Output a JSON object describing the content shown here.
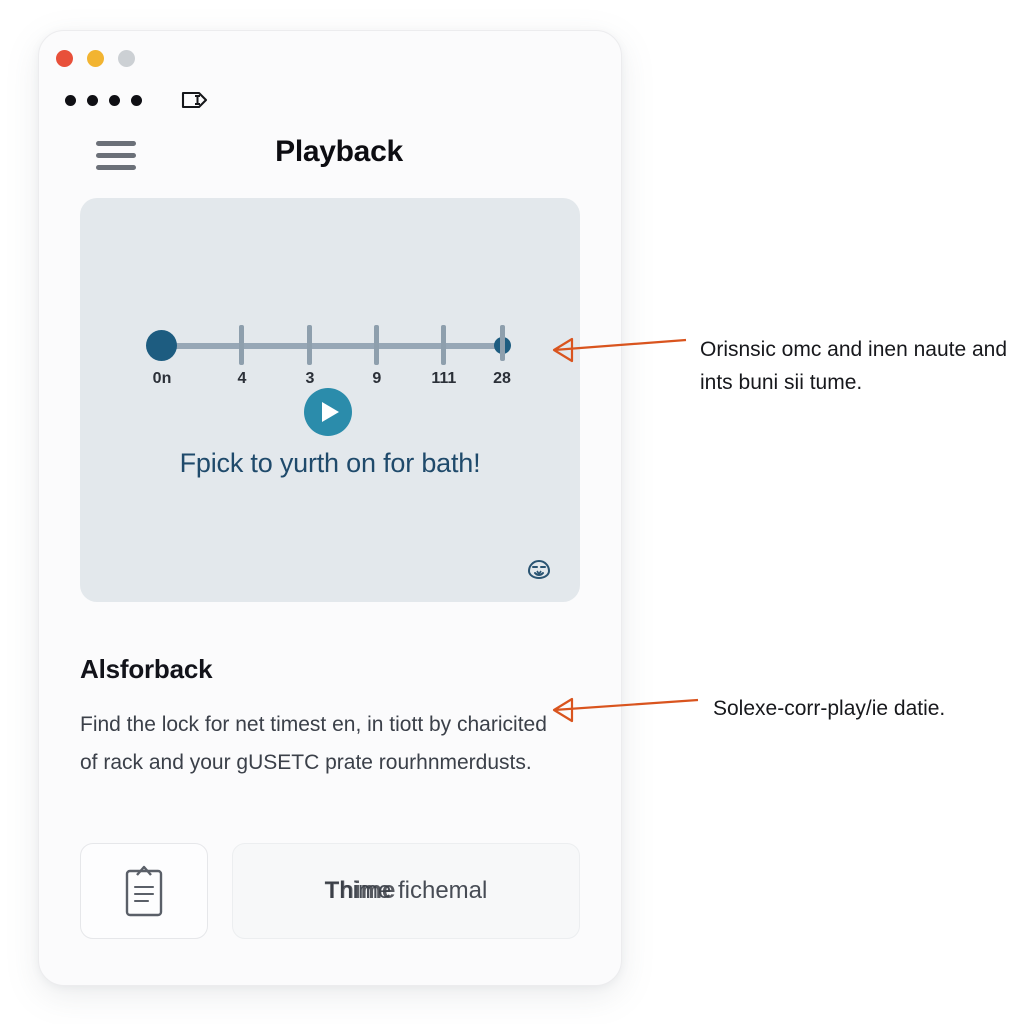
{
  "window": {
    "traffic_lights": [
      {
        "name": "close",
        "color": "#e8503a"
      },
      {
        "name": "minimize",
        "color": "#f2b431"
      },
      {
        "name": "maximize",
        "color": "#ccd0d4"
      }
    ],
    "status_dots_count": 4,
    "tag_icon": "tag-icon"
  },
  "app_bar": {
    "menu_icon": "hamburger-icon",
    "title": "Playback"
  },
  "media_card": {
    "caption": "Fpick to yurth on for bath!",
    "play_icon": "play-icon",
    "corner_icon": "face-icon",
    "timeline": {
      "start_label": "0n",
      "ticks": [
        {
          "label": "0n",
          "pos_pct": 0
        },
        {
          "label": "4",
          "pos_pct": 23.5
        },
        {
          "label": "3",
          "pos_pct": 43.5
        },
        {
          "label": "9",
          "pos_pct": 63.2
        },
        {
          "label": "111",
          "pos_pct": 82.9
        },
        {
          "label": "28",
          "pos_pct": 100
        }
      ]
    }
  },
  "info_section": {
    "heading": "Alsforback",
    "body": "Find the lock for net timest en, in tiott by charicited of rack and your gUSETC prate rourhnmerdusts."
  },
  "actions": {
    "clipboard_icon": "clipboard-icon",
    "primary_label": "Thime fichemal"
  },
  "annotations": [
    {
      "id": "annotation-1",
      "text": "Orisnsic omc and inen naute and ints buni sii tume.",
      "arrow_color": "#d9541e"
    },
    {
      "id": "annotation-2",
      "text": "Solexe-corr-play/ie datie.",
      "arrow_color": "#d9541e"
    }
  ],
  "colors": {
    "accent_teal": "#2b8cab",
    "accent_navy": "#1d5c80",
    "annotation_orange": "#d9541e",
    "card_bg": "#e3e8ec"
  }
}
